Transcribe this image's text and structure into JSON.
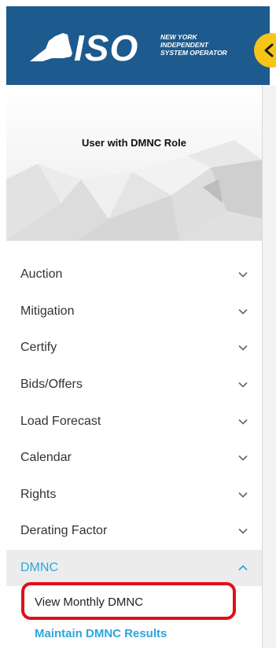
{
  "header": {
    "logo_text": "ISO",
    "logo_subtitle": [
      "NEW YORK",
      "INDEPENDENT",
      "SYSTEM OPERATOR"
    ],
    "bg_color": "#1d5a8e",
    "collapse_icon": "chevron-left-icon",
    "collapse_color": "#f5c518"
  },
  "profile": {
    "role": "User with DMNC Role"
  },
  "menu": {
    "items": [
      {
        "label": "Auction",
        "icon": "chevron-down-icon"
      },
      {
        "label": "Mitigation",
        "icon": "chevron-down-icon"
      },
      {
        "label": "Certify",
        "icon": "chevron-down-icon"
      },
      {
        "label": "Bids/Offers",
        "icon": "chevron-down-icon"
      },
      {
        "label": "Load Forecast",
        "icon": "chevron-down-icon"
      },
      {
        "label": "Calendar",
        "icon": "chevron-down-icon"
      },
      {
        "label": "Rights",
        "icon": "chevron-down-icon"
      },
      {
        "label": "Derating Factor",
        "icon": "chevron-down-icon"
      },
      {
        "label": "DMNC",
        "icon": "chevron-up-icon",
        "expanded": true,
        "children": [
          {
            "label": "View Monthly DMNC",
            "highlighted": true
          },
          {
            "label": "Maintain DMNC Results"
          }
        ]
      }
    ],
    "accent_color": "#2ba6de",
    "highlight_color": "#e1101a"
  }
}
